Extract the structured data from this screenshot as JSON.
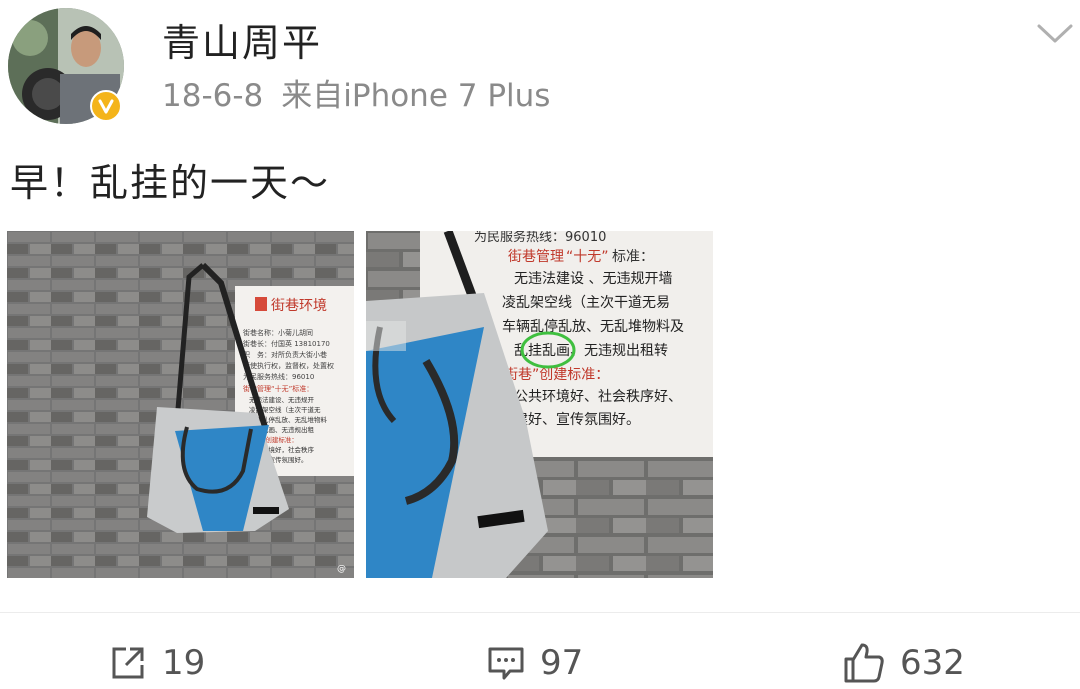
{
  "post": {
    "username": "青山周平",
    "date": "18-6-8",
    "source": "来自iPhone 7 Plus",
    "text": "早！乱挂的一天～",
    "photos": [
      {
        "sign_title": "街巷环境",
        "sign_lines": [
          "街巷名称：小菊儿胡同",
          "街巷长：付国英 13810170",
          "职　务：对所负责大街小巷",
          "行使执行权，监督权，处置权",
          "为民服务热线：96010"
        ],
        "sign_header": "街巷管理“十无”标准：",
        "sign_small": [
          "无违法建设、无违规开",
          "凌乱架空线（主次干道无",
          "车辆乱停乱放、无乱堆物料",
          "乱挂乱画、无违规出租",
          "街巷”创建标准：",
          "公共环境好，社会秩序",
          "建好，宣传氛围好。"
        ],
        "watermark": "@"
      },
      {
        "sign_hotline": "为民服务热线：96010",
        "sign_header_pre": "街巷管理",
        "sign_header_quote": "“十无”",
        "sign_header_post": "标准：",
        "lines": [
          "无违法建设 、无违规开墙",
          "凌乱架空线（主次干道无易",
          "车辆乱停乱放、无乱堆物料及",
          "乱挂乱画、无违规出租转",
          "街巷”创建标准：",
          "公共环境好、社会秩序好、",
          "建好、宣传氛围好。"
        ],
        "highlight": "乱挂"
      }
    ],
    "actions": {
      "repost_count": "19",
      "comment_count": "97",
      "like_count": "632"
    }
  },
  "colors": {
    "verified_badge": "#f4b41a",
    "highlight_circle": "#3fbf3f",
    "bag_blue": "#2f86c6"
  }
}
